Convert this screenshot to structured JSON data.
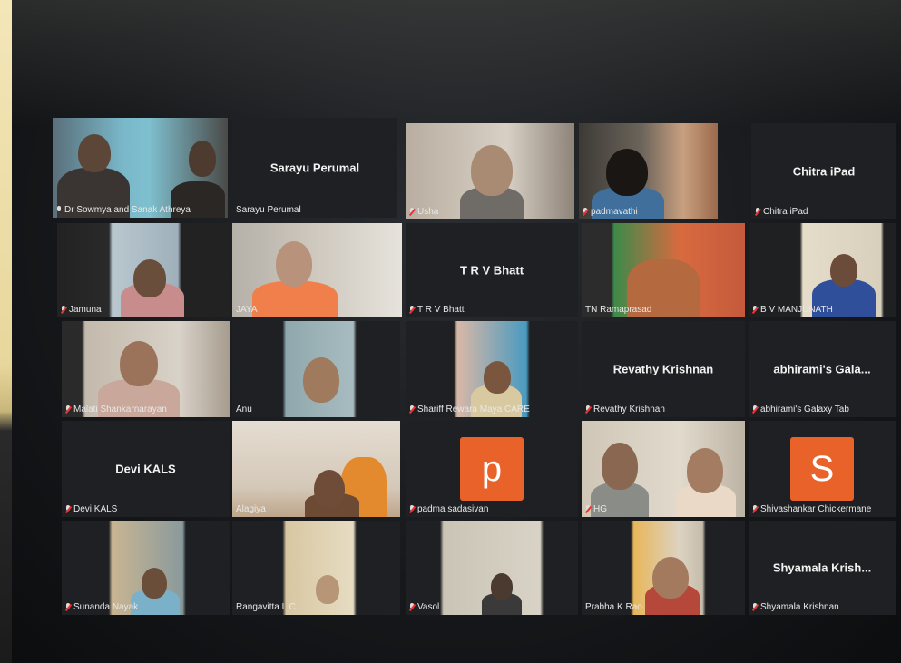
{
  "participants": [
    {
      "name": "Dr Sowmya and Sanak Athreya",
      "mic": "on",
      "video": true,
      "speaking": true
    },
    {
      "name": "Sarayu Perumal",
      "mic": "none",
      "video": false,
      "center_name": "Sarayu Perumal"
    },
    {
      "name": "Usha",
      "mic": "muted",
      "video": true
    },
    {
      "name": "padmavathi",
      "mic": "muted",
      "video": true
    },
    {
      "name": "Chitra iPad",
      "mic": "muted",
      "video": false,
      "center_name": "Chitra iPad"
    },
    {
      "name": "Jamuna",
      "mic": "muted",
      "video": true
    },
    {
      "name": "JAYA",
      "mic": "none",
      "video": true
    },
    {
      "name": "T R V Bhatt",
      "mic": "muted",
      "video": false,
      "center_name": "T R V Bhatt"
    },
    {
      "name": "TN Ramaprasad",
      "mic": "none",
      "video": true
    },
    {
      "name": "B V MANJUNATH",
      "mic": "muted",
      "video": true
    },
    {
      "name": "Malati Shankarnarayan",
      "mic": "muted",
      "video": true
    },
    {
      "name": "Anu",
      "mic": "none",
      "video": true
    },
    {
      "name": "Shariff Rewara Maya CARE",
      "mic": "muted",
      "video": true
    },
    {
      "name": "Revathy Krishnan",
      "mic": "muted",
      "video": false,
      "center_name": "Revathy Krishnan"
    },
    {
      "name": "abhirami's Galaxy Tab",
      "mic": "muted",
      "video": false,
      "center_name": "abhirami's Gala..."
    },
    {
      "name": "Devi KALS",
      "mic": "muted",
      "video": false,
      "center_name": "Devi KALS"
    },
    {
      "name": "Alagiya",
      "mic": "none",
      "video": true
    },
    {
      "name": "padma sadasivan",
      "mic": "muted",
      "video": false,
      "avatar": "p"
    },
    {
      "name": "HG",
      "mic": "muted",
      "video": true
    },
    {
      "name": "Shivashankar Chickermane",
      "mic": "muted",
      "video": false,
      "avatar": "S"
    },
    {
      "name": "Sunanda Nayak",
      "mic": "muted",
      "video": true
    },
    {
      "name": "Rangavitta L C",
      "mic": "none",
      "video": true
    },
    {
      "name": "Vasol",
      "mic": "muted",
      "video": true
    },
    {
      "name": "Prabha K Rao",
      "mic": "none",
      "video": true
    },
    {
      "name": "Shyamala Krishnan",
      "mic": "muted",
      "video": false,
      "center_name": "Shyamala Krish..."
    }
  ],
  "colors": {
    "active_speaker": "#c9dc3c",
    "avatar_bg": "#e8622a",
    "muted": "#e33333"
  }
}
